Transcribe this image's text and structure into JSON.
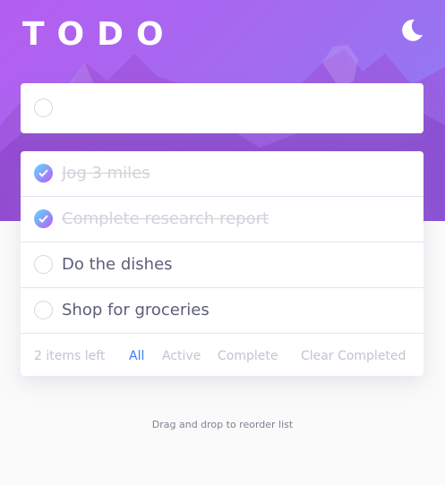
{
  "app": {
    "title": "TODO",
    "theme_icon": "moon-icon"
  },
  "colors": {
    "accent": "#3a7cfd",
    "check_gradient_start": "#57ddff",
    "check_gradient_end": "#c058f3",
    "hero_start": "#b45ef0",
    "hero_end": "#8b7ff3"
  },
  "new_todo": {
    "value": "",
    "placeholder": ""
  },
  "todos": [
    {
      "text": "Jog 3 miles",
      "completed": true
    },
    {
      "text": "Complete research report",
      "completed": true
    },
    {
      "text": "Do the dishes",
      "completed": false
    },
    {
      "text": "Shop for groceries",
      "completed": false
    }
  ],
  "footer": {
    "items_left": "2 items left",
    "filters": {
      "all": "All",
      "active": "Active",
      "complete": "Complete"
    },
    "selected_filter": "All",
    "clear_completed": "Clear Completed"
  },
  "hint": "Drag and drop to reorder list"
}
